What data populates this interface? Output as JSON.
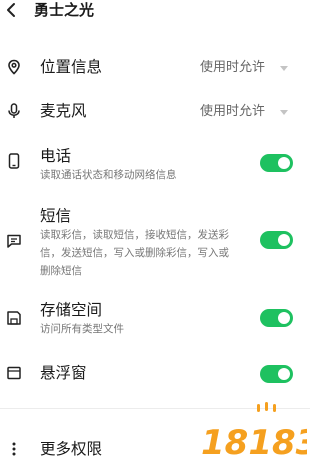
{
  "header": {
    "title": "勇士之光"
  },
  "permissions": [
    {
      "title": "位置信息",
      "value": "使用时允许"
    },
    {
      "title": "麦克风",
      "value": "使用时允许"
    },
    {
      "title": "电话",
      "desc": "读取通话状态和移动网络信息",
      "enabled": true
    },
    {
      "title": "短信",
      "desc_lines": [
        "读取彩信，读取短信，接收短信，发送彩",
        "信，发送短信，写入或删除彩信，写入或",
        "删除短信"
      ],
      "enabled": true
    },
    {
      "title": "存储空间",
      "desc": "访问所有类型文件",
      "enabled": true
    },
    {
      "title": "悬浮窗",
      "enabled": true
    }
  ],
  "more": {
    "title": "更多权限"
  },
  "watermark": {
    "text": "18183"
  },
  "colors": {
    "toggle_on": "#1ec160",
    "watermark_orange": "#f5a01f"
  }
}
